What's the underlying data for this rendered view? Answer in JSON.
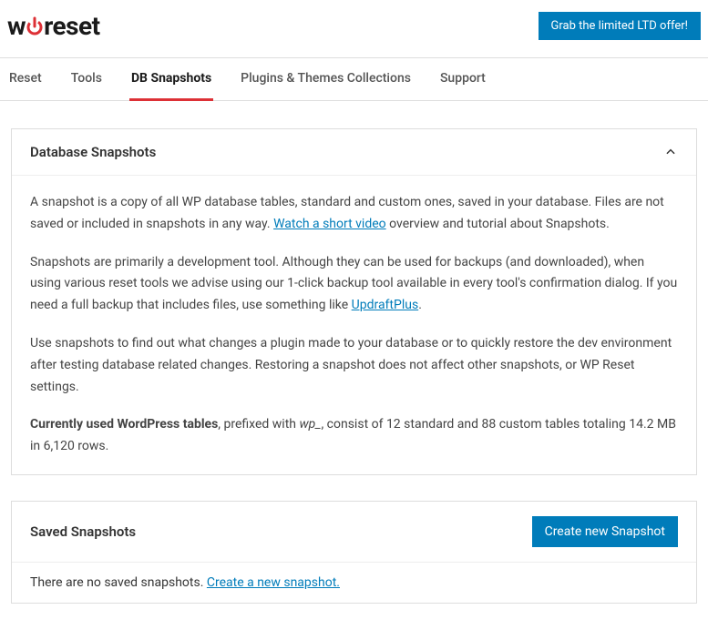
{
  "header": {
    "logo_prefix": "w",
    "logo_p": "p",
    "logo_suffix": "reset",
    "ltd_button": "Grab the limited LTD offer!"
  },
  "tabs": {
    "reset": "Reset",
    "tools": "Tools",
    "db_snapshots": "DB Snapshots",
    "plugins_themes": "Plugins & Themes Collections",
    "support": "Support"
  },
  "db_panel": {
    "title": "Database Snapshots",
    "p1_a": "A snapshot is a copy of all WP database tables, standard and custom ones, saved in your database. Files are not saved or included in snapshots in any way. ",
    "p1_link": "Watch a short video",
    "p1_b": " overview and tutorial about Snapshots.",
    "p2_a": "Snapshots are primarily a development tool. Although they can be used for backups (and downloaded), when using various reset tools we advise using our 1-click backup tool available in every tool's confirmation dialog. If you need a full backup that includes files, use something like ",
    "p2_link": "UpdraftPlus",
    "p2_b": ".",
    "p3": "Use snapshots to find out what changes a plugin made to your database or to quickly restore the dev environment after testing database related changes. Restoring a snapshot does not affect other snapshots, or WP Reset settings.",
    "p4_bold": "Currently used WordPress tables",
    "p4_a": ", prefixed with ",
    "p4_prefix": "wp_",
    "p4_b": ", consist of 12 standard and 88 custom tables totaling 14.2 MB in 6,120 rows."
  },
  "saved_panel": {
    "title": "Saved Snapshots",
    "create_button": "Create new Snapshot",
    "empty_a": "There are no saved snapshots. ",
    "empty_link": "Create a new snapshot."
  }
}
